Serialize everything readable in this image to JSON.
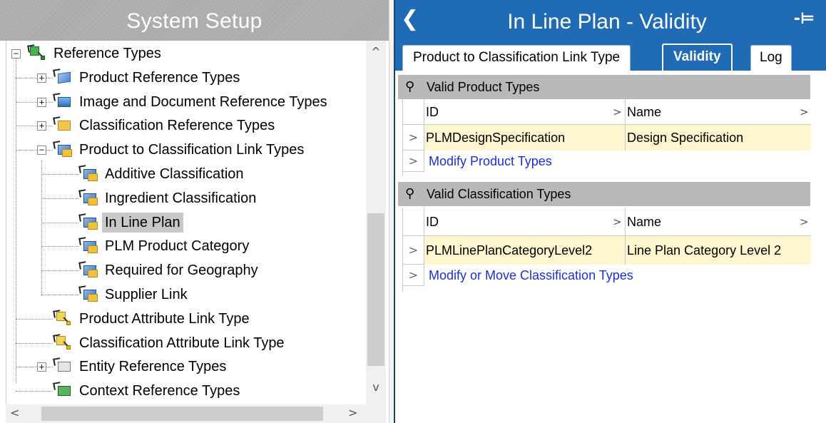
{
  "left_panel": {
    "title": "System Setup",
    "tree": [
      {
        "label": "Reference Types",
        "icon": "reference-types-icon",
        "level": 0,
        "expander": "−"
      },
      {
        "label": "Product Reference Types",
        "icon": "cube-icon",
        "level": 1,
        "expander": "+"
      },
      {
        "label": "Image and Document Reference Types",
        "icon": "image-icon",
        "level": 1,
        "expander": "+"
      },
      {
        "label": "Classification Reference Types",
        "icon": "folder-icon",
        "level": 1,
        "expander": "+"
      },
      {
        "label": "Product to Classification Link Types",
        "icon": "link-type-icon",
        "level": 1,
        "expander": "−"
      },
      {
        "label": "Additive Classification",
        "icon": "link-type-icon",
        "level": 2,
        "expander": ""
      },
      {
        "label": "Ingredient Classification",
        "icon": "link-type-icon",
        "level": 2,
        "expander": ""
      },
      {
        "label": "In Line Plan",
        "icon": "link-type-icon",
        "level": 2,
        "expander": "",
        "selected": true
      },
      {
        "label": "PLM Product Category",
        "icon": "link-type-icon",
        "level": 2,
        "expander": ""
      },
      {
        "label": "Required for Geography",
        "icon": "link-type-icon",
        "level": 2,
        "expander": ""
      },
      {
        "label": "Supplier Link",
        "icon": "link-type-icon",
        "level": 2,
        "expander": ""
      },
      {
        "label": "Product Attribute Link Type",
        "icon": "attribute-link-icon",
        "level": 1,
        "expander": ""
      },
      {
        "label": "Classification Attribute Link Type",
        "icon": "attribute-link-icon",
        "level": 1,
        "expander": ""
      },
      {
        "label": "Entity Reference Types",
        "icon": "entity-icon",
        "level": 1,
        "expander": "+"
      },
      {
        "label": "Context Reference Types",
        "icon": "context-icon",
        "level": 1,
        "expander": ""
      }
    ]
  },
  "right_panel": {
    "title": "In Line Plan - Validity",
    "back_icon": "chevron-left-icon",
    "pin_icon": "pin-icon",
    "tabs": [
      {
        "label": "Product to Classification Link Type",
        "active": false
      },
      {
        "label": "Validity",
        "active": true
      },
      {
        "label": "Log",
        "active": false
      }
    ],
    "sections": [
      {
        "header": "Valid Product Types",
        "columns": [
          "ID",
          "Name"
        ],
        "rows": [
          {
            "id": "PLMDesignSpecification",
            "name": "Design Specification"
          }
        ],
        "action": "Modify Product Types"
      },
      {
        "header": "Valid Classification Types",
        "columns": [
          "ID",
          "Name"
        ],
        "rows": [
          {
            "id": "PLMLinePlanCategoryLevel2",
            "name": "Line Plan Category Level 2"
          }
        ],
        "action": "Modify or Move Classification Types"
      }
    ]
  },
  "glyphs": {
    "row_arrow": ">",
    "sort": ">",
    "scroll_up": "^",
    "scroll_down": "v",
    "scroll_left": "<",
    "scroll_right": ">"
  },
  "colors": {
    "header_blue": "#1f6bb5",
    "highlight_row": "#fff6cf",
    "link": "#1c2fd6",
    "section_gray": "#b9b9b9"
  }
}
